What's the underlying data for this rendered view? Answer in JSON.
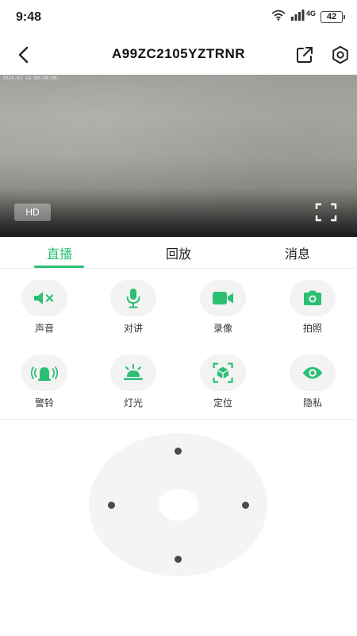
{
  "status_bar": {
    "time": "9:48",
    "network": "4G",
    "battery": "42"
  },
  "nav": {
    "title": "A99ZC2105YZTRNR"
  },
  "video": {
    "osd_text": "2024-03-18 09:48:09",
    "quality_label": "HD"
  },
  "tabs": [
    {
      "label": "直播",
      "active": true
    },
    {
      "label": "回放",
      "active": false
    },
    {
      "label": "消息",
      "active": false
    }
  ],
  "controls": [
    {
      "label": "声音",
      "icon": "speaker-muted-icon"
    },
    {
      "label": "对讲",
      "icon": "microphone-icon"
    },
    {
      "label": "录像",
      "icon": "video-camera-icon"
    },
    {
      "label": "拍照",
      "icon": "camera-icon"
    },
    {
      "label": "警铃",
      "icon": "alarm-bell-icon"
    },
    {
      "label": "灯光",
      "icon": "light-icon"
    },
    {
      "label": "定位",
      "icon": "locate-icon"
    },
    {
      "label": "隐私",
      "icon": "eye-icon"
    }
  ],
  "colors": {
    "accent": "#2bbf74",
    "control_bg": "#f3f3f3",
    "joystick_bg": "#f4f4f4"
  }
}
